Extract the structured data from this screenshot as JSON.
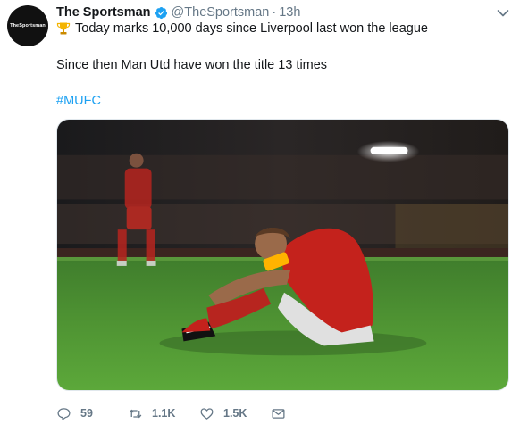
{
  "tweet": {
    "author_name": "The Sportsman",
    "handle": "@TheSportsman",
    "separator": "·",
    "time": "13h",
    "avatar_text": "TheSportsman",
    "line1": "Today marks 10,000 days since Liverpool last won the league",
    "line2": "Since then Man Utd have won the title 13 times",
    "hashtag": "#MUFC",
    "icons": {
      "verified": "verified-badge-icon",
      "menu": "chevron-down-icon",
      "emoji": "trophy-icon",
      "reply": "reply-icon",
      "retweet": "retweet-icon",
      "like": "heart-icon",
      "message": "envelope-icon"
    },
    "colors": {
      "accent": "#1da1f2",
      "muted": "#657786",
      "text": "#14171a"
    }
  },
  "actions": {
    "reply_count": "59",
    "retweet_count": "1.1K",
    "like_count": "1.5K"
  }
}
